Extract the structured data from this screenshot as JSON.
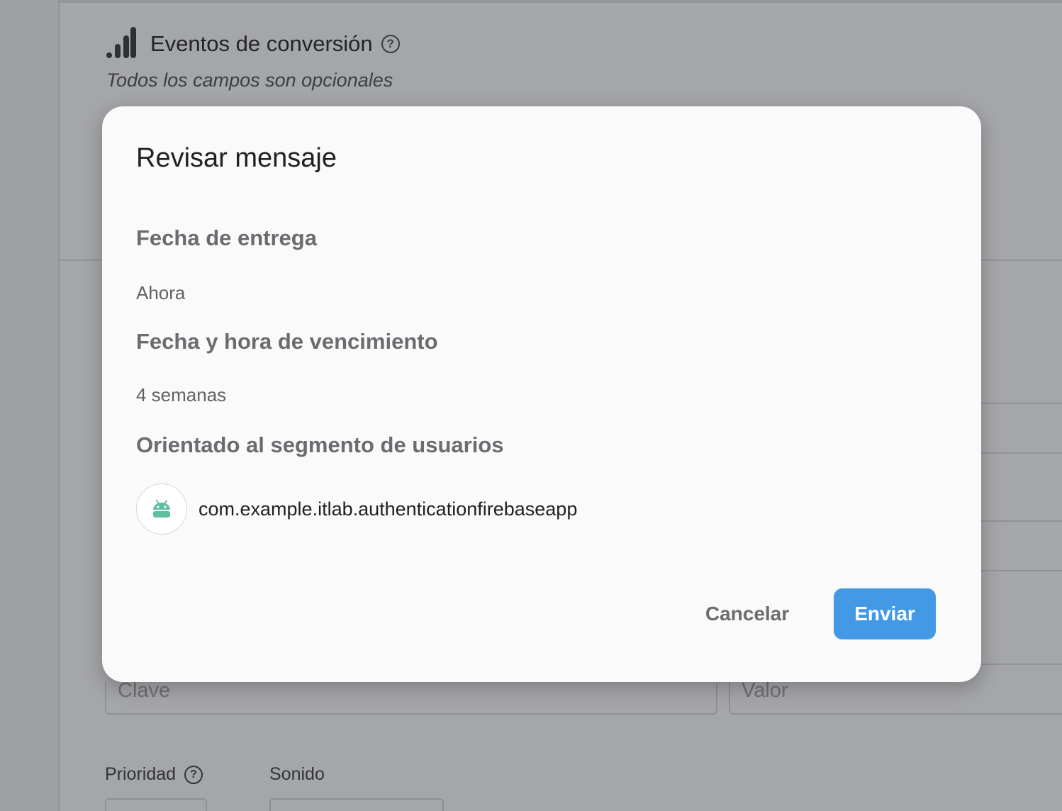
{
  "background": {
    "section_title": "Eventos de conversión",
    "section_subtitle": "Todos los campos son opcionales",
    "key_placeholder": "Clave",
    "value_placeholder": "Valor",
    "priority_label": "Prioridad",
    "sound_label": "Sonido",
    "help_glyph": "?"
  },
  "dialog": {
    "title": "Revisar mensaje",
    "delivery_heading": "Fecha de entrega",
    "delivery_value": "Ahora",
    "expiry_heading": "Fecha y hora de vencimiento",
    "expiry_value": "4 semanas",
    "targeting_heading": "Orientado al segmento de usuarios",
    "target_app": "com.example.itlab.authenticationfirebaseapp",
    "target_icon": "android-icon",
    "cancel_label": "Cancelar",
    "send_label": "Enviar"
  },
  "colors": {
    "scrim": "#a5a6a9",
    "dialog_bg": "#fafafa",
    "primary": "#4399e4",
    "android_green": "#3ddc84"
  }
}
